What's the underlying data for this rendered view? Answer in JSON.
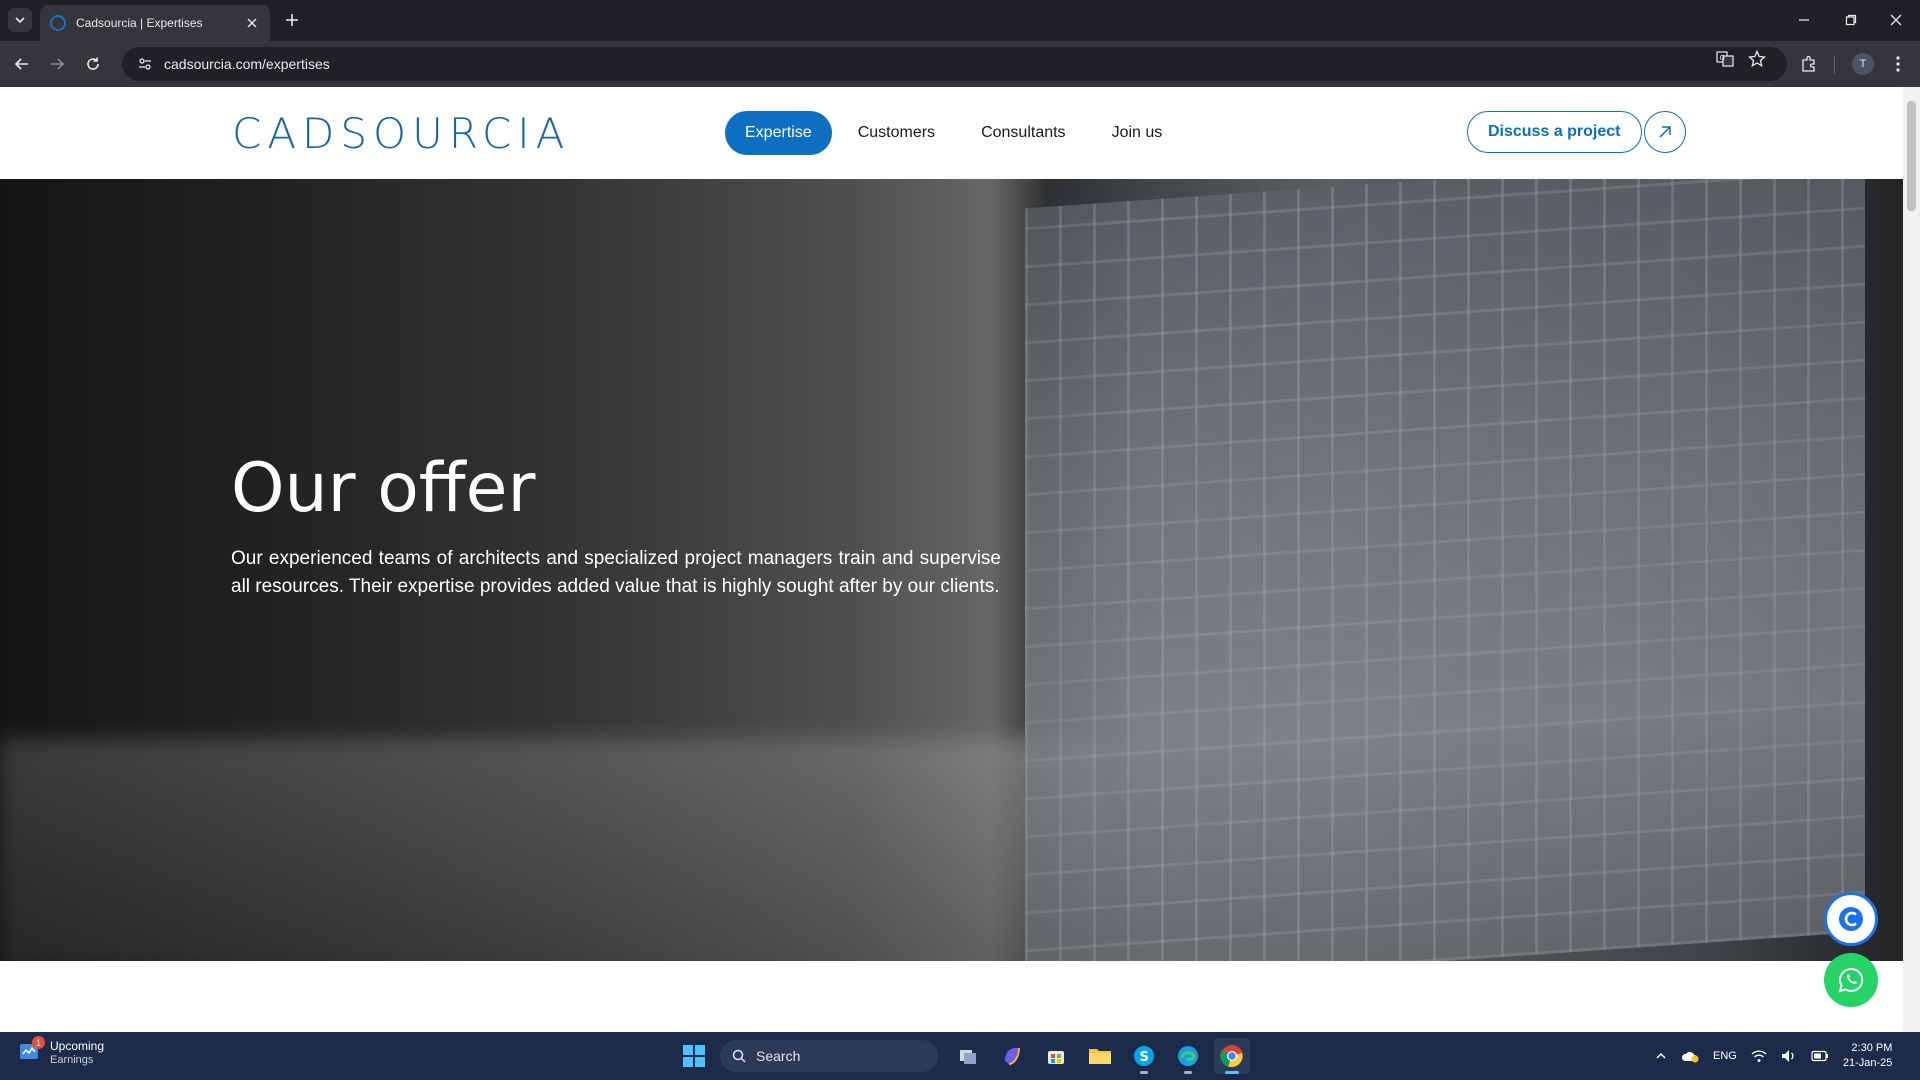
{
  "browser": {
    "tab_title": "Cadsourcia | Expertises",
    "url": "cadsourcia.com/expertises",
    "profile_initial": "T"
  },
  "site": {
    "logo_text": "CADSOURCIA",
    "nav": [
      {
        "label": "Expertise",
        "active": true
      },
      {
        "label": "Customers",
        "active": false
      },
      {
        "label": "Consultants",
        "active": false
      },
      {
        "label": "Join us",
        "active": false
      }
    ],
    "cta_label": "Discuss a project",
    "hero": {
      "title": "Our offer",
      "text": "Our experienced teams of architects and specialized project managers train and supervise all resources. Their expertise provides added value that is highly sought after by our clients."
    }
  },
  "taskbar": {
    "widget_title": "Upcoming",
    "widget_sub": "Earnings",
    "widget_badge": "1",
    "search_placeholder": "Search",
    "language": "ENG",
    "time": "2:30 PM",
    "date": "21-Jan-25"
  },
  "colors": {
    "brand": "#0d6fc2",
    "whatsapp": "#25d366",
    "taskbar": "#1c2b4a"
  }
}
